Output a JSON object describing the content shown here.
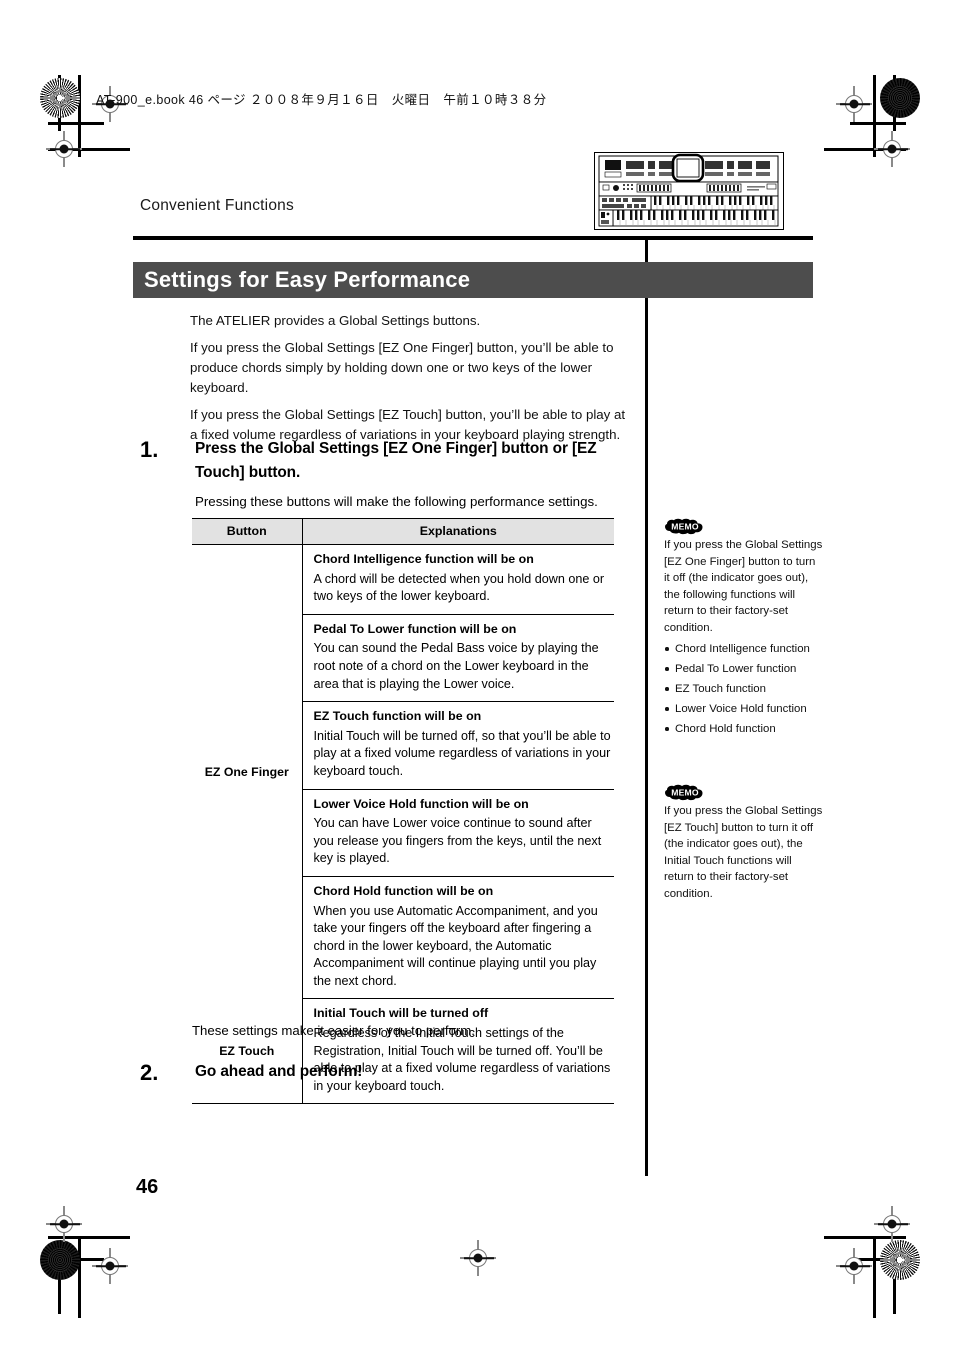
{
  "book_header": "AT-900_e.book 46 ページ ２００８年９月１６日　火曜日　午前１０時３８分",
  "running_head": "Convenient Functions",
  "title": "Settings for Easy Performance",
  "intro": [
    "The ATELIER provides a Global Settings buttons.",
    "If you press the Global Settings [EZ One Finger] button, you’ll be able to produce chords simply by holding down one or two keys of the lower keyboard.",
    "If you press the Global Settings [EZ Touch] button, you’ll be able to play at a fixed volume regardless of variations in your keyboard playing strength."
  ],
  "steps": [
    {
      "number": "1.",
      "heading": "Press the Global Settings [EZ One Finger] button or [EZ Touch] button.",
      "sub": "Pressing these buttons will make the following performance settings."
    },
    {
      "number": "2.",
      "heading": "Go ahead and perform!",
      "sub": ""
    }
  ],
  "table": {
    "headers": [
      "Button",
      "Explanations"
    ],
    "groups": [
      {
        "button": "EZ One Finger",
        "rows": [
          {
            "title": "Chord Intelligence function will be on",
            "body": "A chord will be detected when you hold down one or two keys of the lower keyboard."
          },
          {
            "title": "Pedal To Lower function will be on",
            "body": "You can sound the Pedal Bass voice by playing the root note of a chord on the Lower keyboard in the area that is playing the Lower voice."
          },
          {
            "title": "EZ Touch function will be on",
            "body": "Initial Touch will be turned off, so that you’ll be able to play at a fixed volume regardless of variations in your keyboard touch."
          },
          {
            "title": "Lower Voice Hold function will be on",
            "body": "You can have Lower voice continue to sound after you release you fingers from the keys, until the next key is played."
          },
          {
            "title": "Chord Hold function will be on",
            "body": "When you use Automatic Accompaniment, and you take your fingers off the keyboard after fingering a chord in the lower keyboard, the Automatic Accompaniment will continue playing until you play the next chord."
          }
        ]
      },
      {
        "button": "EZ Touch",
        "rows": [
          {
            "title": "Initial Touch will be turned off",
            "body": "Regardless of the Initial Touch settings of the Registration, Initial Touch will be turned off. You’ll be able to play at a fixed volume regardless of variations in your keyboard touch."
          }
        ]
      }
    ]
  },
  "after_table": "These settings make it easier for you to perform.",
  "memos": [
    {
      "badge": "MEMO",
      "text": "If you press the Global Settings [EZ One Finger] button to turn it off (the indicator goes out), the following functions will return to their factory-set condition.",
      "items": [
        "Chord Intelligence function",
        "Pedal To Lower function",
        "EZ Touch function",
        "Lower Voice Hold function",
        "Chord Hold function"
      ]
    },
    {
      "badge": "MEMO",
      "text": "If you press the Global Settings [EZ Touch] button to turn it off (the indicator goes out), the Initial Touch functions will return to their factory-set condition.",
      "items": []
    }
  ],
  "page_number": "46",
  "colors": {
    "title_bar": "#4d4d4d",
    "table_header": "#e2e2e2",
    "text": "#111111"
  }
}
